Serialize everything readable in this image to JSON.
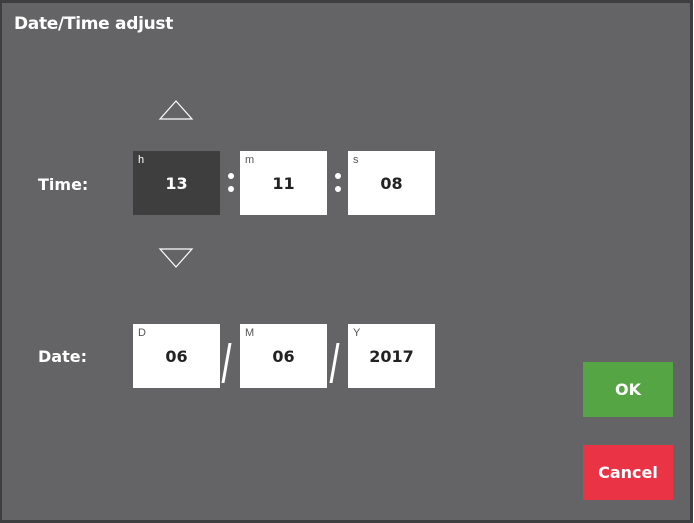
{
  "title": "Date/Time adjust",
  "time": {
    "label": "Time:",
    "hours": {
      "unit": "h",
      "value": "13"
    },
    "minutes": {
      "unit": "m",
      "value": "11"
    },
    "seconds": {
      "unit": "s",
      "value": "08"
    },
    "increment_icon": "triangle-up-icon",
    "decrement_icon": "triangle-down-icon"
  },
  "date": {
    "label": "Date:",
    "day": {
      "unit": "D",
      "value": "06"
    },
    "month": {
      "unit": "M",
      "value": "06"
    },
    "year": {
      "unit": "Y",
      "value": "2017"
    }
  },
  "buttons": {
    "ok_label": "OK",
    "cancel_label": "Cancel"
  },
  "colors": {
    "background": "#646365",
    "selected_field": "#3d3e3d",
    "ok": "#56a545",
    "cancel": "#ea3446"
  }
}
